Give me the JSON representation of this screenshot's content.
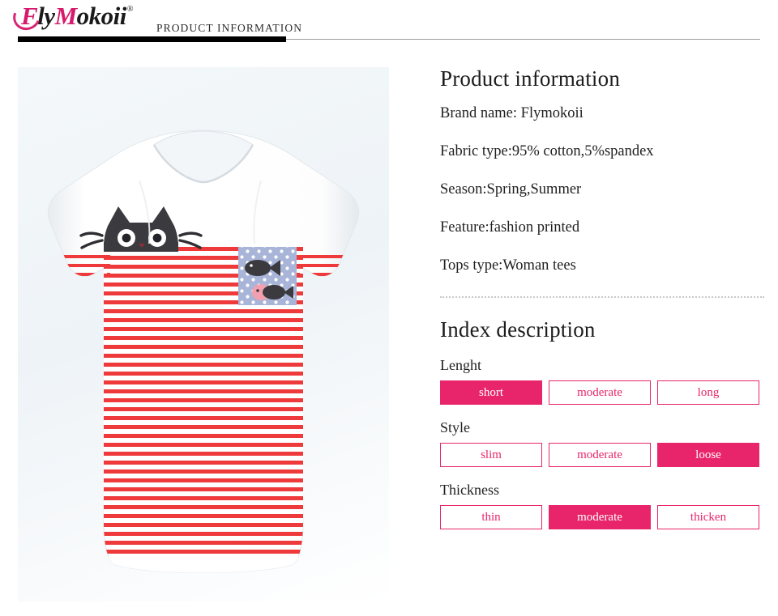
{
  "header": {
    "logo": {
      "part1": "F",
      "part2": "ly",
      "part3": "M",
      "part4": "okoii",
      "registered": "®"
    },
    "title": "PRODUCT  INFORMATION"
  },
  "product_image": {
    "alt": "white short-sleeve tee with red horizontal stripes, peeking black cat print and blue polka-dot pocket with two fish",
    "colors": {
      "stripe_red": "#ee3a3a",
      "shirt_white": "#ffffff",
      "cat_dark": "#3a3a3f",
      "pocket_blue": "#a8b4d8",
      "pocket_dot": "#ffffff",
      "fish_pink": "#f2a0ad",
      "panel_bg": "#eef3f7"
    }
  },
  "product_information": {
    "title": "Product information",
    "specs": [
      "Brand name: Flymokoii",
      "Fabric type:95% cotton,5%spandex",
      "Season:Spring,Summer",
      "Feature:fashion printed",
      "Tops type:Woman tees"
    ]
  },
  "index_description": {
    "title": "Index description",
    "accent_color": "#E8256A",
    "groups": [
      {
        "label": "Lenght",
        "options": [
          {
            "label": "short",
            "selected": true
          },
          {
            "label": "moderate",
            "selected": false
          },
          {
            "label": "long",
            "selected": false
          }
        ]
      },
      {
        "label": "Style",
        "options": [
          {
            "label": "slim",
            "selected": false
          },
          {
            "label": "moderate",
            "selected": false
          },
          {
            "label": "loose",
            "selected": true
          }
        ]
      },
      {
        "label": "Thickness",
        "options": [
          {
            "label": "thin",
            "selected": false
          },
          {
            "label": "moderate",
            "selected": true
          },
          {
            "label": "thicken",
            "selected": false
          }
        ]
      }
    ]
  }
}
